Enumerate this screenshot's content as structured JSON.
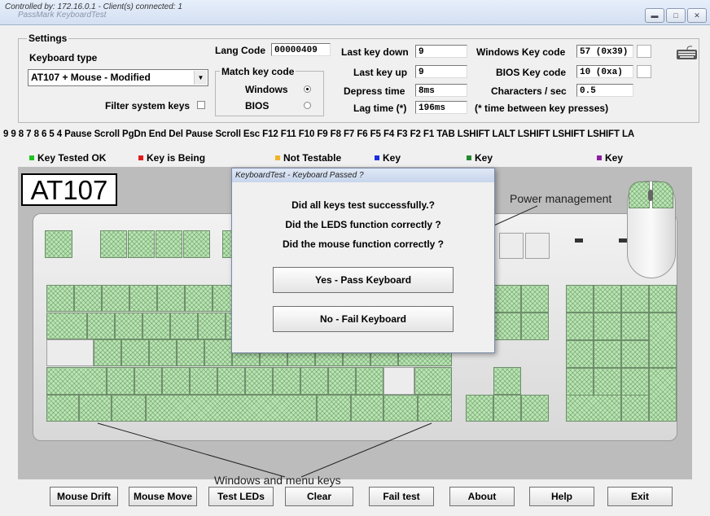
{
  "window": {
    "title": "Controlled by: 172.16.0.1 - Client(s) connected: 1",
    "app_title_faint": "PassMark KeyboardTest",
    "controls": [
      "minimize",
      "maximize",
      "close"
    ]
  },
  "settings": {
    "group_label": "Settings",
    "keyboard_type_label": "Keyboard type",
    "keyboard_type_value": "AT107 + Mouse - Modified",
    "filter_label": "Filter system keys",
    "filter_checked": false,
    "lang_code_label": "Lang Code",
    "lang_code_value": "00000409",
    "match_group_label": "Match key code",
    "match_windows_label": "Windows",
    "match_bios_label": "BIOS",
    "match_selected": "Windows",
    "last_key_down_label": "Last key down",
    "last_key_down_value": "9",
    "last_key_up_label": "Last key up",
    "last_key_up_value": "9",
    "depress_time_label": "Depress time",
    "depress_time_value": "8ms",
    "lag_time_label": "Lag time (*)",
    "lag_time_value": "196ms",
    "windows_key_code_label": "Windows Key code",
    "windows_key_code_value": "57 (0x39)",
    "bios_key_code_label": "BIOS Key code",
    "bios_key_code_value": "10 (0xa)",
    "chars_per_sec_label": "Characters / sec",
    "chars_per_sec_value": "0.5",
    "lag_note": "(* time between key presses)"
  },
  "key_history": "9 9 8 7 8 6 5 4 Pause Scroll PgDn End Del Pause Scroll Esc F12 F11 F10 F9 F8 F7 F6 F5 F4 F3 F2 F1 TAB LSHIFT LALT LSHIFT LSHIFT LSHIFT LA",
  "legend": [
    {
      "label": "Key Tested OK",
      "color": "#22c322"
    },
    {
      "label": "Key is Being",
      "color": "#e01c1c"
    },
    {
      "label": "Not Testable",
      "color": "#f0b429"
    },
    {
      "label": "Key",
      "color": "#1c2fe0"
    },
    {
      "label": "Key",
      "color": "#23892f"
    },
    {
      "label": "Key",
      "color": "#8a1fa0"
    }
  ],
  "keyboard": {
    "model_label": "AT107",
    "power_label": "Power management",
    "windows_keys_label": "Windows and menu keys",
    "tested_key_color": "#b9e6b2"
  },
  "dialog": {
    "title": "KeyboardTest - Keyboard Passed ?",
    "q1": "Did all keys test successfully.?",
    "q2": "Did the LEDS function correctly ?",
    "q3": "Did the mouse function correctly ?",
    "pass_label": "Yes - Pass Keyboard",
    "fail_label": "No - Fail Keyboard"
  },
  "buttons": {
    "mouse_drift": "Mouse Drift",
    "mouse_move": "Mouse Move",
    "test_leds": "Test LEDs",
    "clear": "Clear",
    "fail_test": "Fail test",
    "about": "About",
    "help": "Help",
    "exit": "Exit"
  }
}
